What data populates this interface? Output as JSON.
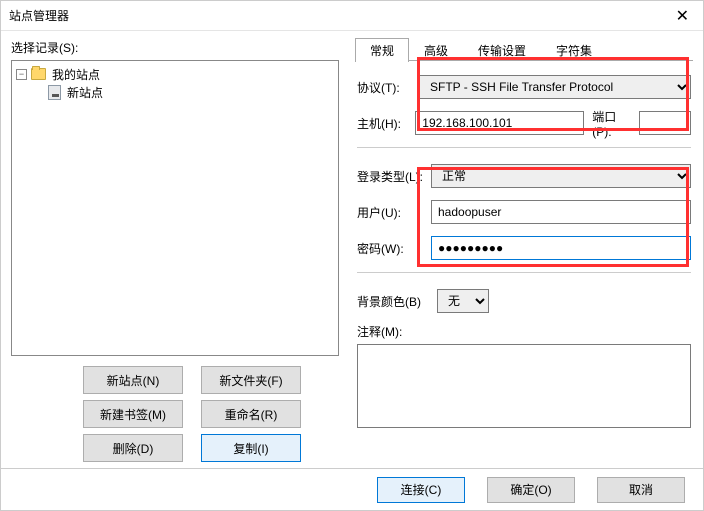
{
  "window": {
    "title": "站点管理器"
  },
  "left": {
    "select_record": "选择记录(S):",
    "root_label": "我的站点",
    "child_label": "新站点",
    "buttons": {
      "new_site": "新站点(N)",
      "new_folder": "新文件夹(F)",
      "new_bookmark": "新建书签(M)",
      "rename": "重命名(R)",
      "delete": "删除(D)",
      "copy": "复制(I)"
    }
  },
  "tabs": {
    "general": "常规",
    "advanced": "高级",
    "transfer": "传输设置",
    "charset": "字符集"
  },
  "fields": {
    "protocol_label": "协议(T):",
    "protocol_value": "SFTP - SSH File Transfer Protocol",
    "host_label": "主机(H):",
    "host_value": "192.168.100.101",
    "port_label": "端口(P):",
    "port_value": "",
    "login_type_label": "登录类型(L):",
    "login_type_value": "正常",
    "user_label": "用户(U):",
    "user_value": "hadoopuser",
    "password_label": "密码(W):",
    "password_value": "●●●●●●●●●",
    "bgcolor_label": "背景颜色(B)",
    "bgcolor_value": "无",
    "notes_label": "注释(M):",
    "notes_value": ""
  },
  "footer": {
    "connect": "连接(C)",
    "ok": "确定(O)",
    "cancel": "取消"
  }
}
